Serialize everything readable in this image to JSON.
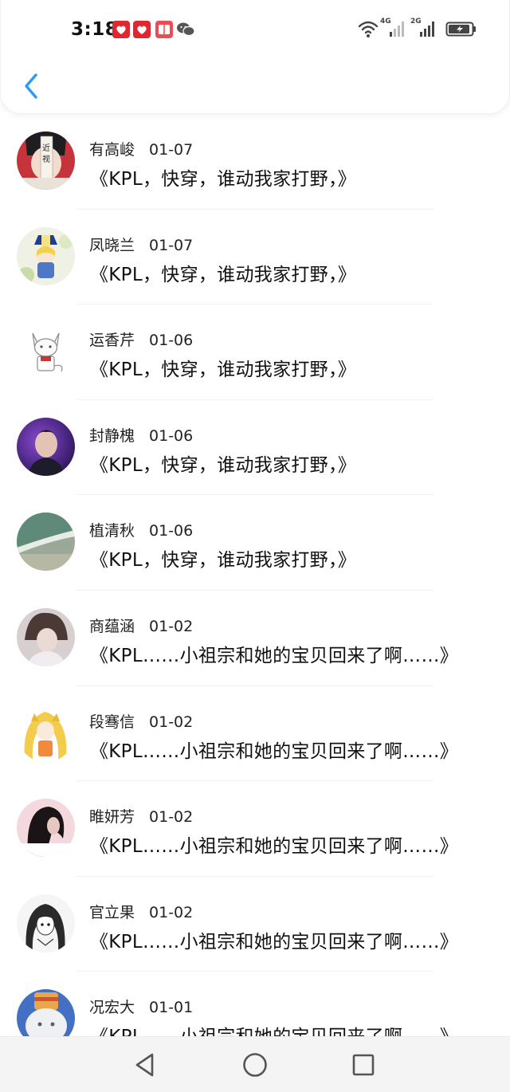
{
  "status_bar": {
    "time": "3:18",
    "notification_icons": [
      "red-app-icon",
      "red-app-icon",
      "book-app-icon",
      "wechat-icon"
    ],
    "network_labels": [
      "4G",
      "2G"
    ],
    "system_icons": [
      "wifi-icon",
      "signal-icon",
      "signal-icon",
      "battery-charging-icon"
    ]
  },
  "header": {
    "back_icon": "chevron-left-icon",
    "accent_color": "#2b9bf4"
  },
  "messages": [
    {
      "name": "有高峻",
      "date": "01-07",
      "text": "《KPL，快穿，谁动我家打野，》",
      "avatar": "anime-boy-avatar"
    },
    {
      "name": "凤晓兰",
      "date": "01-07",
      "text": "《KPL，快穿，谁动我家打野，》",
      "avatar": "anime-girl-avatar"
    },
    {
      "name": "运香芹",
      "date": "01-06",
      "text": "《KPL，快穿，谁动我家打野，》",
      "avatar": "cat-avatar"
    },
    {
      "name": "封静槐",
      "date": "01-06",
      "text": "《KPL，快穿，谁动我家打野，》",
      "avatar": "portrait-avatar"
    },
    {
      "name": "植清秋",
      "date": "01-06",
      "text": "《KPL，快穿，谁动我家打野，》",
      "avatar": "beach-avatar"
    },
    {
      "name": "商蕴涵",
      "date": "01-02",
      "text": "《KPL……小祖宗和她的宝贝回来了啊……》",
      "avatar": "girl-photo-avatar"
    },
    {
      "name": "段骞信",
      "date": "01-02",
      "text": "《KPL……小祖宗和她的宝贝回来了啊……》",
      "avatar": "yellow-anime-avatar"
    },
    {
      "name": "睢妍芳",
      "date": "01-02",
      "text": "《KPL……小祖宗和她的宝贝回来了啊……》",
      "avatar": "dark-hair-avatar"
    },
    {
      "name": "官立果",
      "date": "01-02",
      "text": "《KPL……小祖宗和她的宝贝回来了啊……》",
      "avatar": "sketch-anime-avatar"
    },
    {
      "name": "况宏大",
      "date": "01-01",
      "text": "《KPL……小祖宗和她的宝贝回来了啊……》",
      "avatar": "cat-photo-avatar"
    }
  ],
  "navbar": {
    "buttons": [
      "back-triangle-icon",
      "home-circle-icon",
      "recents-square-icon"
    ]
  }
}
